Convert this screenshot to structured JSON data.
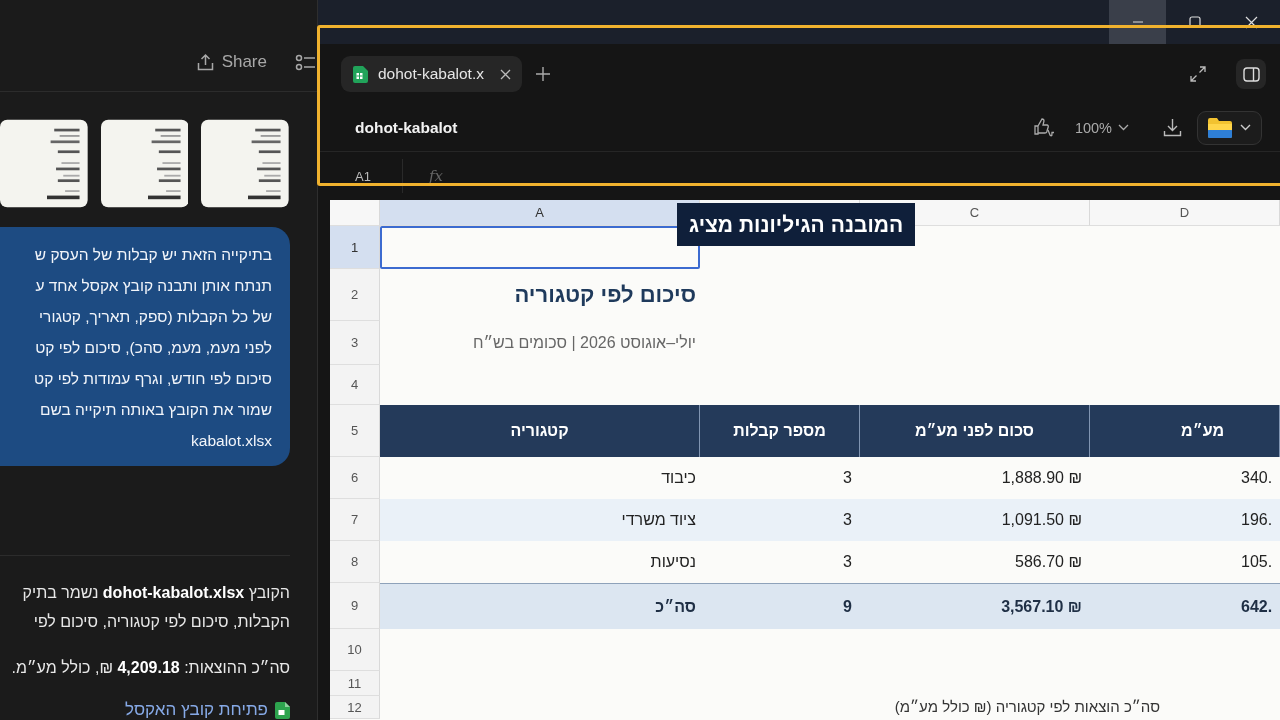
{
  "chat_panel": {
    "share_button": "Share",
    "attachments": [
      {
        "kind": "picture"
      },
      {
        "kind": "picture"
      },
      {
        "kind": "picture"
      }
    ],
    "message_lines": [
      "בתיקייה הזאת יש קבלות של העסק ש",
      "תנתח אותן ותבנה קובץ אקסל אחד ע",
      "של כל הקבלות (ספק, תאריך, קטגורי",
      "לפני מעמ, מעמ, סהכ), סיכום לפי קט",
      "סיכום לפי חודש, וגרף עמודות לפי קט",
      "שמור את הקובץ באותה תיקייה בשם",
      "kabalot.xlsx"
    ],
    "reply_lines": [
      "הקובץ **dohot-kabalot.xlsx** נשמר בתיק",
      "הקבלות, סיכום לפי קטגוריה, סיכום לפי"
    ],
    "total_line": "סה״כ ההוצאות: **4,209.18** ₪, כולל מע״מ.",
    "open_link": "פתיחת קובץ האקסל"
  },
  "viewer": {
    "tab": {
      "label": "dohot-kabalot.x",
      "selected": true
    },
    "file_title": "dohot-kabalot",
    "zoom": "100%",
    "cell_ref": "A1",
    "formula_label": "fx"
  },
  "sheet": {
    "column_headers": [
      {
        "letter": "D",
        "selected": false
      },
      {
        "letter": "C",
        "selected": false
      },
      {
        "letter": "A",
        "selected": true
      }
    ],
    "rows": [
      {
        "number": "1",
        "selected": true
      },
      {
        "number": "2",
        "selected": false
      },
      {
        "number": "3",
        "selected": false
      },
      {
        "number": "4",
        "selected": false
      },
      {
        "number": "5",
        "selected": false
      },
      {
        "number": "6",
        "selected": false
      },
      {
        "number": "7",
        "selected": false
      },
      {
        "number": "8",
        "selected": false
      },
      {
        "number": "9",
        "selected": false
      },
      {
        "number": "10",
        "selected": false
      },
      {
        "number": "11",
        "selected": false
      },
      {
        "number": "12",
        "selected": false
      }
    ],
    "title": "סיכום לפי קטגוריה",
    "subtitle": "יולי–אוגוסט 2026 | סכומים בש״ח",
    "table_header": [
      "מע״מ",
      "סכום לפני מע״מ",
      "מספר קבלות",
      "קטגוריה"
    ],
    "table_rows": [
      {
        "kind": "data",
        "cells": [
          "340.",
          "1,888.90 ₪",
          "3",
          "כיבוד"
        ]
      },
      {
        "kind": "data",
        "cells": [
          "196.",
          "1,091.50 ₪",
          "3",
          "ציוד משרדי"
        ]
      },
      {
        "kind": "data",
        "cells": [
          "105.",
          "586.70 ₪",
          "3",
          "נסיעות"
        ]
      },
      {
        "kind": "total",
        "cells": [
          "642.",
          "3,567.10 ₪",
          "9",
          "סה״כ"
        ]
      }
    ],
    "chart_title": "סה״כ הוצאות לפי קטגוריה (₪ כולל מע״מ)"
  },
  "caption": "מציג הגיליונות המובנה"
}
